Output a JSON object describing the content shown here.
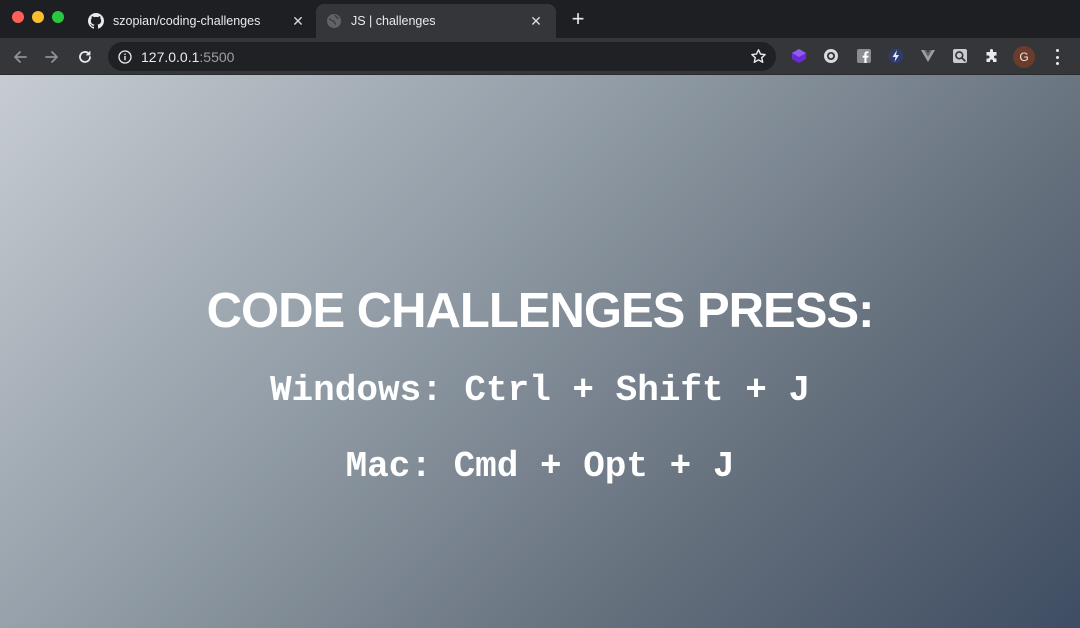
{
  "browser": {
    "tabs": [
      {
        "title": "szopian/coding-challenges",
        "favicon": "github-icon",
        "active": false
      },
      {
        "title": "JS | challenges",
        "favicon": "globe-icon",
        "active": true
      }
    ],
    "new_tab_label": "+",
    "address": {
      "host": "127.0.0.1",
      "port": ":5500"
    },
    "profile_initial": "G",
    "extensions": [
      "purple-cube-extension-icon",
      "circle-extension-icon",
      "facebook-extension-icon",
      "lightning-extension-icon",
      "vue-devtools-icon",
      "search-extension-icon",
      "puzzle-icon"
    ]
  },
  "page": {
    "heading": "CODE CHALLENGES PRESS:",
    "windows_shortcut": "Windows: Ctrl + Shift + J",
    "mac_shortcut": "Mac: Cmd + Opt + J"
  },
  "colors": {
    "gradient_start": "#c6ccd2",
    "gradient_end": "#3f4d63",
    "text": "#ffffff"
  }
}
